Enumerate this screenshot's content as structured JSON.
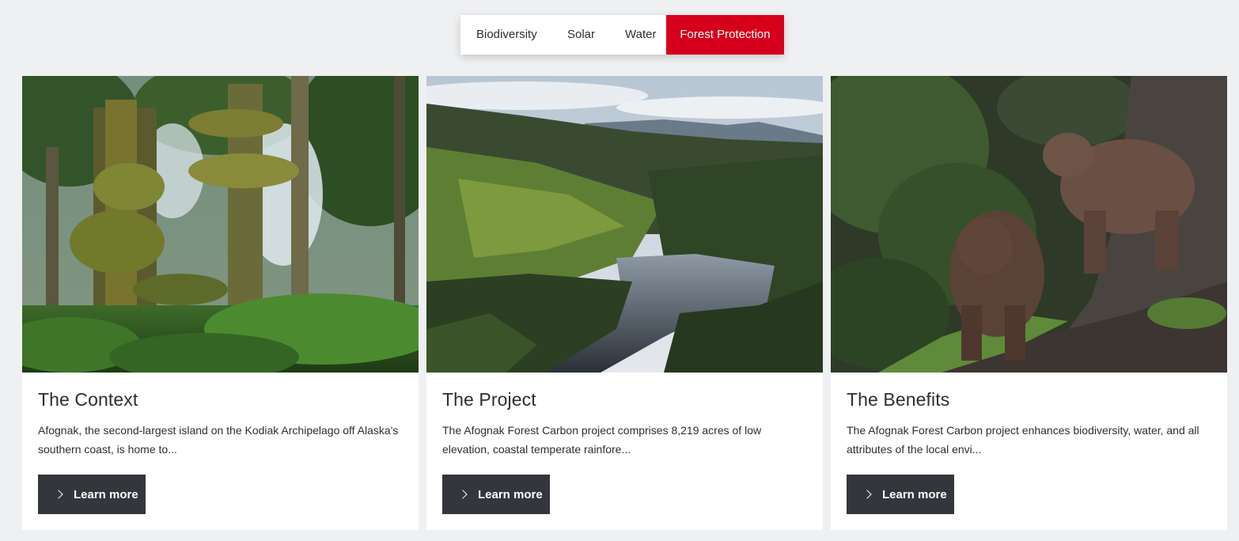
{
  "tabs": [
    {
      "label": "Biodiversity",
      "active": false
    },
    {
      "label": "Solar",
      "active": false
    },
    {
      "label": "Water",
      "active": false
    },
    {
      "label": "Forest Protection",
      "active": true
    }
  ],
  "colors": {
    "accent": "#d6001c",
    "background": "#eff0f2",
    "button": "#33373b",
    "text": "#2b2f33"
  },
  "cards": [
    {
      "image_subject": "mossy old-growth spruce forest",
      "title": "The Context",
      "text": "Afognak, the second-largest island on the Kodiak Archipelago off Alaska's southern coast, is home to...",
      "button_label": "Learn more",
      "button_icon": "chevron-right-icon"
    },
    {
      "image_subject": "aerial view of lake in forested valley",
      "title": "The Project",
      "text": "The Afognak Forest Carbon project comprises 8,219 acres of low elevation, coastal temperate rainfore...",
      "button_label": "Learn more",
      "button_icon": "chevron-right-icon"
    },
    {
      "image_subject": "two brown bears on a forest slope",
      "title": "The Benefits",
      "text": "The Afognak Forest Carbon project enhances biodiversity, water, and all attributes of the local envi...",
      "button_label": "Learn more",
      "button_icon": "chevron-right-icon"
    }
  ]
}
